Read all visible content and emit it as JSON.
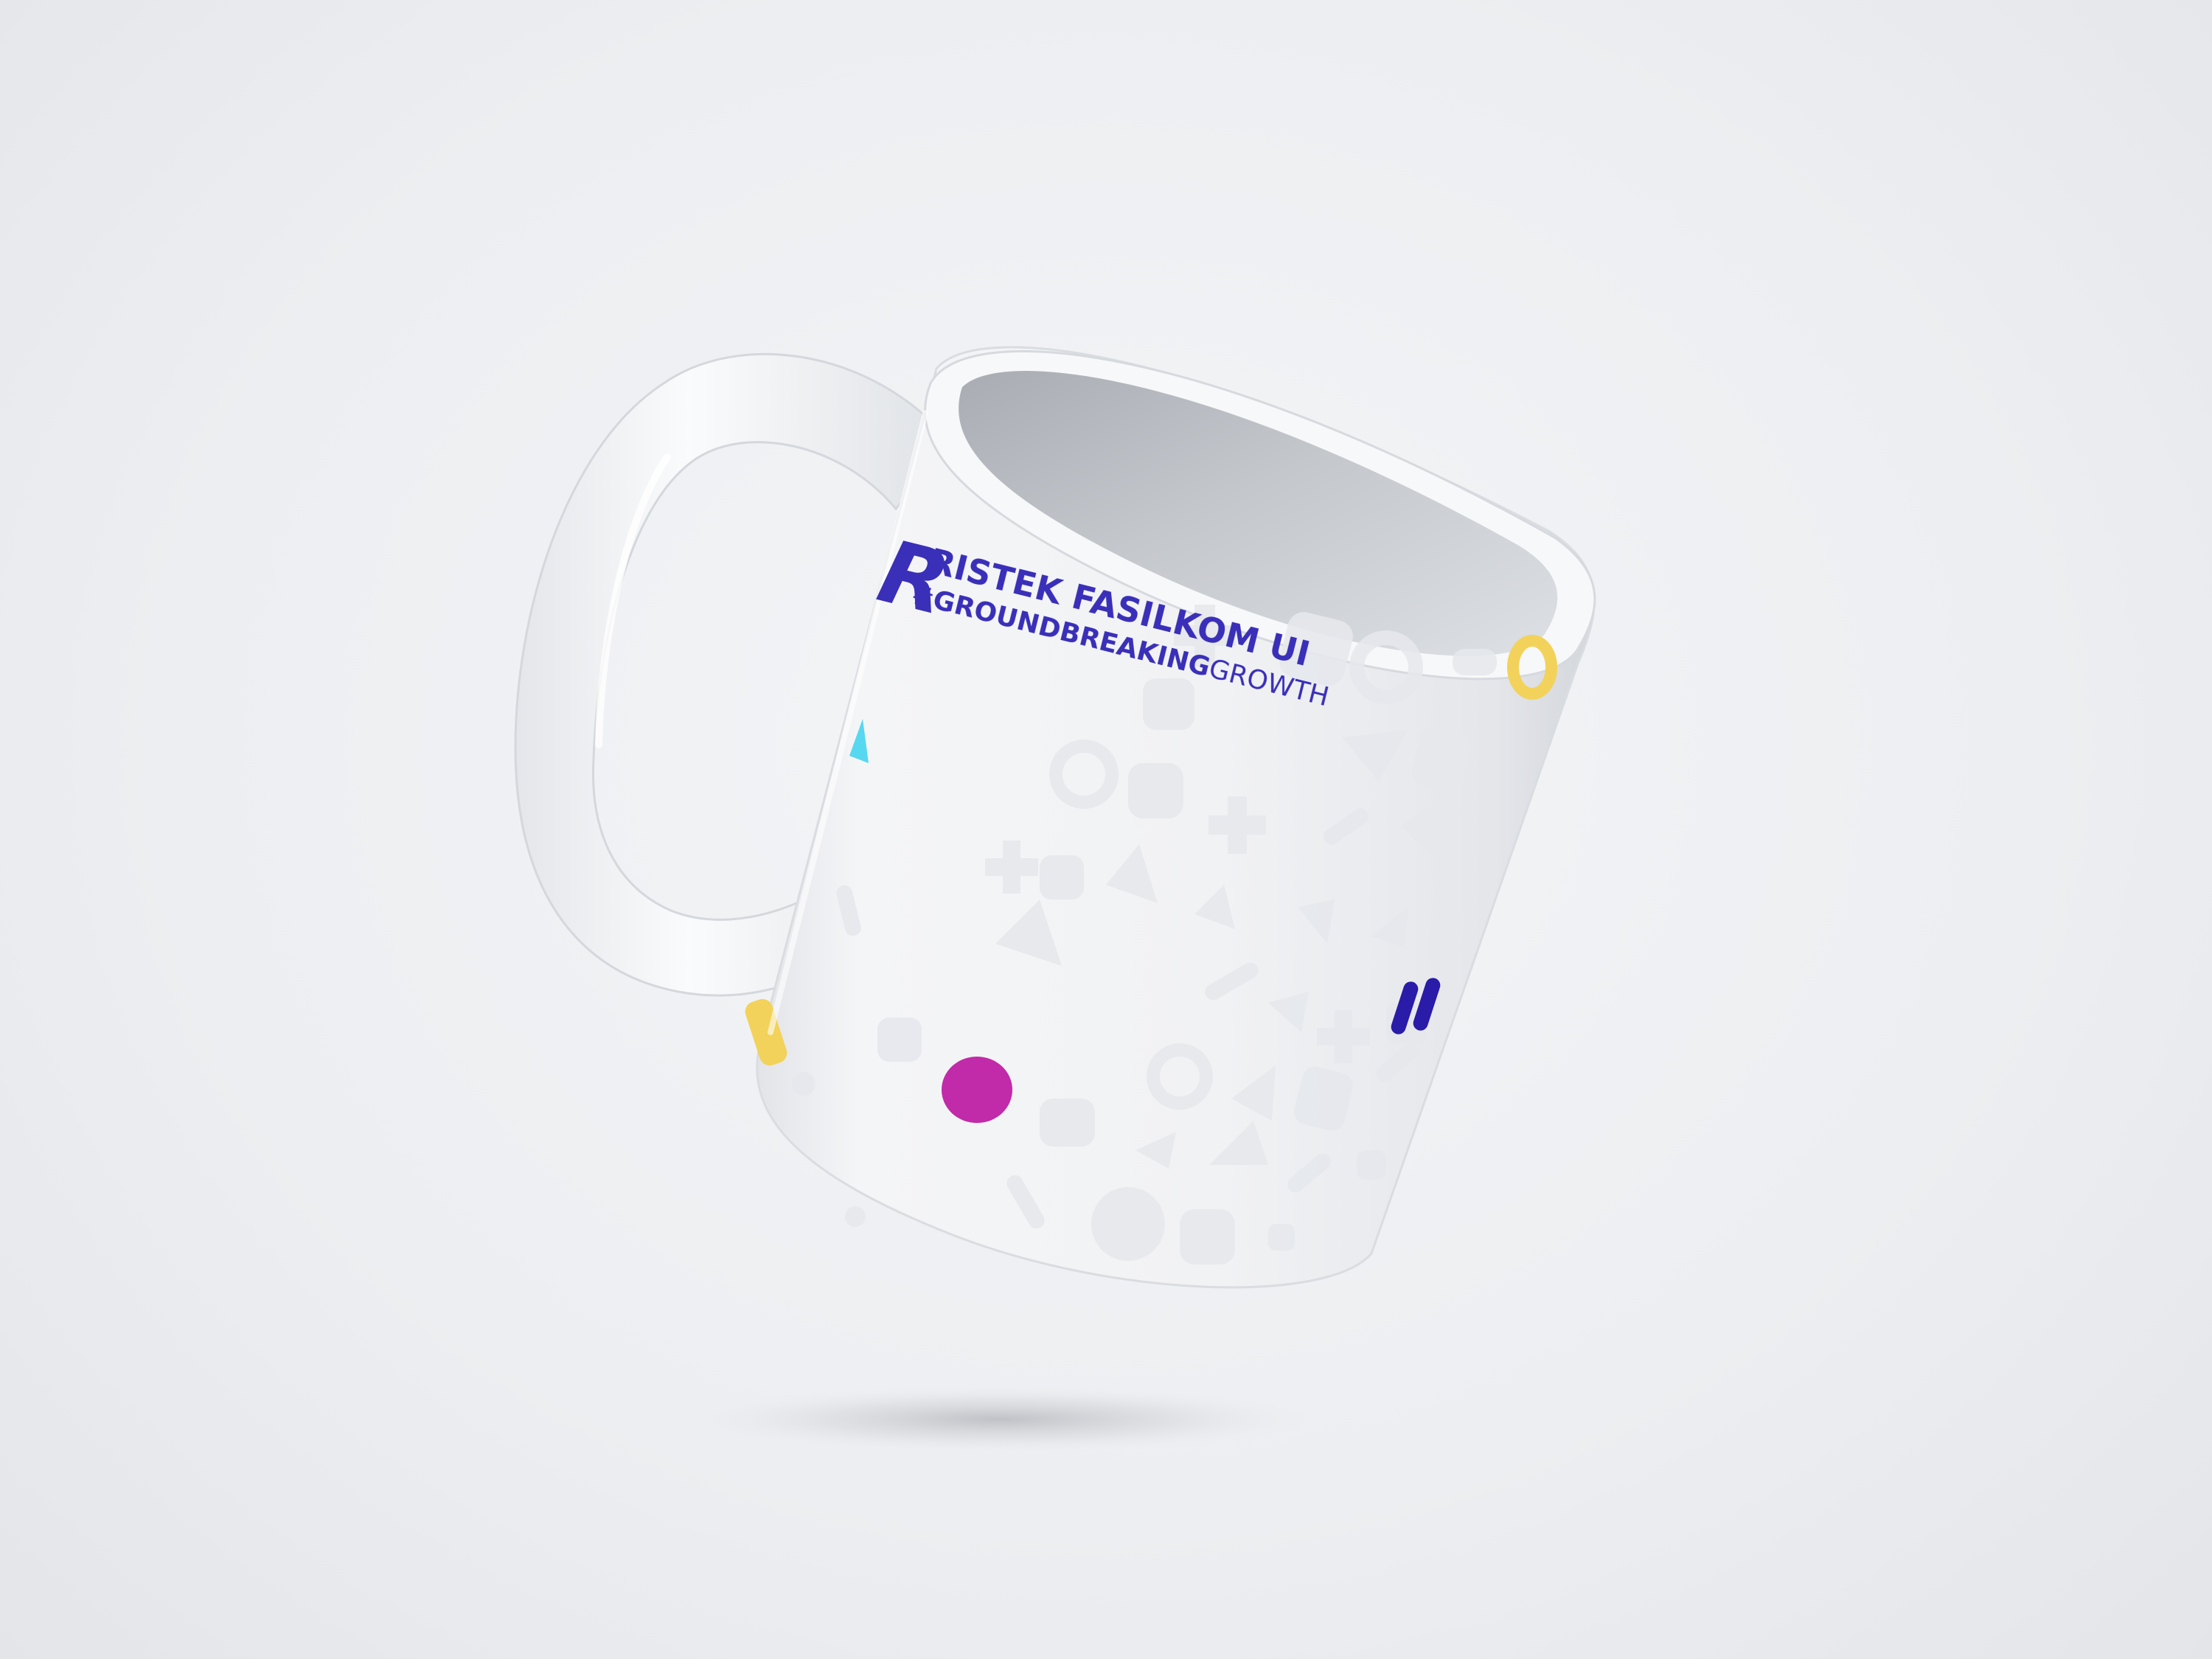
{
  "label": {
    "logo": "R",
    "title": "RISTEK FASILKOM UI",
    "tagline_hash": "#",
    "tagline_bold": "GROUNDBREAKING",
    "tagline_light": "GROWTH"
  },
  "colors": {
    "brand": "#3a2fb8",
    "yellow": "#f2d25a",
    "magenta": "#c12aa8",
    "cyan": "#56d8f0",
    "navy": "#2a1ba8",
    "mug_white": "#f3f4f6",
    "background": "#eceef1"
  },
  "decorations": [
    "yellow-ring",
    "cyan-triangle",
    "yellow-rounded-square",
    "magenta-dot",
    "navy-double-bars",
    "faint-geometric-pattern"
  ]
}
